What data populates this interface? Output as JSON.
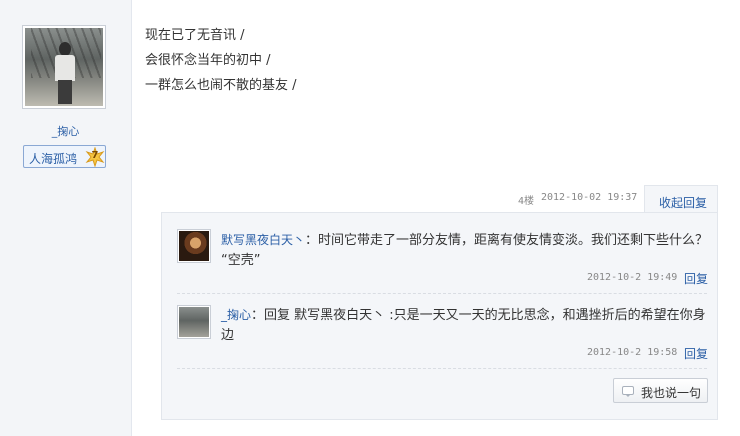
{
  "author": {
    "name": "_掬心",
    "badge_label": "人海孤鸿",
    "badge_level": "7"
  },
  "post": {
    "lines": [
      "现在已了无音讯 /",
      "会很怀念当年的初中 /",
      "一群怎么也闹不散的基友 /"
    ]
  },
  "floor_meta": {
    "floor": "4楼",
    "timestamp": "2012-10-02 19:37",
    "collapse_label": "收起回复"
  },
  "replies": [
    {
      "author": "默写黑夜白天丶",
      "text": "：时间它带走了一部分友情，距离有使友情变淡。我们还剩下些什么？    “空壳”",
      "date": "2012-10-2 19:49",
      "reply_label": "回复"
    },
    {
      "author": "_掬心",
      "text": "：回复 默写黑夜白天丶 :只是一天又一天的无比思念，和遇挫折后的希望在你身边",
      "date": "2012-10-2 19:58",
      "reply_label": "回复"
    }
  ],
  "say_button_label": "我也说一句",
  "colors": {
    "link": "#2b5fa6",
    "side_bg": "#f3f5f8",
    "reply_bg": "#f4f6f9"
  }
}
